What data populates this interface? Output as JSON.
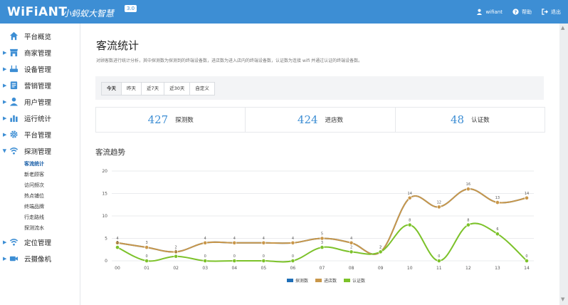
{
  "header": {
    "logo": "WiFiANT",
    "slogan": "小蚂蚁大智慧",
    "version": "3.0",
    "user_name": "wifiant",
    "help_label": "帮助",
    "logout_label": "退出"
  },
  "sidebar": {
    "items": [
      {
        "label": "平台概览"
      },
      {
        "label": "商家管理"
      },
      {
        "label": "设备管理"
      },
      {
        "label": "营销管理"
      },
      {
        "label": "用户管理"
      },
      {
        "label": "运行统计"
      },
      {
        "label": "平台管理"
      },
      {
        "label": "探测管理"
      }
    ],
    "subitems": [
      "客流统计",
      "新老顾客",
      "访问频次",
      "热点铺位",
      "终端品牌",
      "行走路线",
      "探测流水"
    ],
    "items_after": [
      {
        "label": "定位管理"
      },
      {
        "label": "云摄像机"
      }
    ]
  },
  "page": {
    "title": "客流统计",
    "description": "对顾客数进行统计分析，其中探测数为探测到的终端设备数，进店数为进入店内的终端设备数，认证数为连接 wifi 并通过认证的终端设备数。"
  },
  "tabs": [
    "今天",
    "昨天",
    "近7天",
    "近30天",
    "自定义"
  ],
  "stats": [
    {
      "value": "427",
      "label": "探测数"
    },
    {
      "value": "424",
      "label": "进店数"
    },
    {
      "value": "48",
      "label": "认证数"
    }
  ],
  "section_title": "客流趋势",
  "colors": {
    "accent": "#3d8ed4",
    "series1": "#1f6fb8",
    "series2": "#c9974a",
    "series3": "#7cc22a"
  },
  "chart_data": {
    "type": "line",
    "categories": [
      "00",
      "01",
      "02",
      "03",
      "04",
      "05",
      "06",
      "07",
      "08",
      "09",
      "10",
      "11",
      "12",
      "13",
      "14"
    ],
    "ylim": [
      0,
      20
    ],
    "yticks": [
      0,
      5,
      10,
      15,
      20
    ],
    "series": [
      {
        "name": "探测数",
        "values": [
          4,
          3,
          2,
          4,
          4,
          4,
          4,
          5,
          4,
          2,
          14,
          12,
          16,
          13,
          14
        ]
      },
      {
        "name": "进店数",
        "values": [
          4,
          3,
          2,
          4,
          4,
          4,
          4,
          5,
          4,
          2,
          14,
          12,
          16,
          13,
          14
        ]
      },
      {
        "name": "认证数",
        "values": [
          3,
          0,
          1,
          0,
          0,
          0,
          0,
          3,
          2,
          2,
          8,
          0,
          8,
          6,
          0
        ]
      }
    ],
    "legend": "bottom"
  }
}
